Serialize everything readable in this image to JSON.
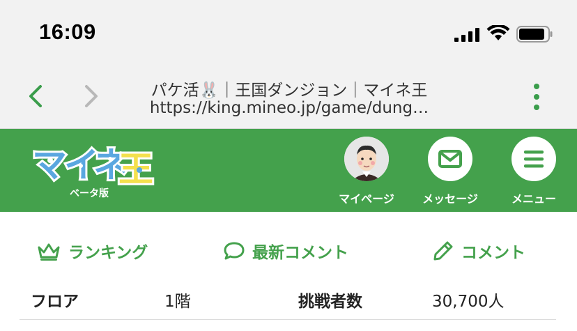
{
  "status_bar": {
    "time": "16:09",
    "icons": [
      "signal-icon",
      "wifi-icon",
      "battery-icon"
    ]
  },
  "browser": {
    "title": "パケ活🐰｜王国ダンジョン｜マイネ王",
    "url": "https://king.mineo.jp/game/dung…",
    "icons": [
      "back-arrow-icon",
      "forward-arrow-icon",
      "more-vertical-icon"
    ]
  },
  "header": {
    "logo_text": "マイネ王",
    "logo_sub": "ベータ版",
    "buttons": [
      {
        "label": "マイページ",
        "icon": "avatar-icon"
      },
      {
        "label": "メッセージ",
        "icon": "envelope-icon"
      },
      {
        "label": "メニュー",
        "icon": "hamburger-icon"
      }
    ],
    "colors": {
      "brand_green": "#44a14c",
      "logo_blue": "#5aa7e0",
      "logo_yellow": "#f4e04d"
    }
  },
  "tabs": [
    {
      "label": "ランキング",
      "icon": "crown-icon"
    },
    {
      "label": "最新コメント",
      "icon": "speech-bubble-icon"
    },
    {
      "label": "コメント",
      "icon": "pencil-icon"
    }
  ],
  "info": {
    "floor_label": "フロア",
    "floor_value": "1階",
    "challengers_label": "挑戦者数",
    "challengers_value": "30,700人"
  }
}
